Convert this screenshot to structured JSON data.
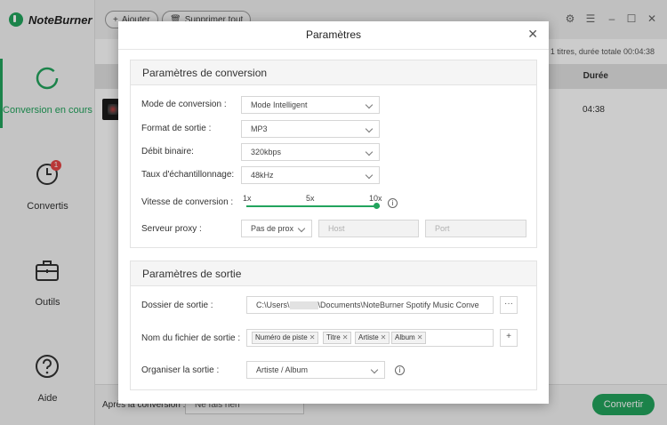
{
  "app": {
    "name": "NoteBurner"
  },
  "sidebar": {
    "items": [
      {
        "label": "Conversion en cours",
        "icon": "conversion-ring-icon",
        "active": true
      },
      {
        "label": "Convertis",
        "icon": "clock-icon",
        "badge": "1"
      },
      {
        "label": "Outils",
        "icon": "toolbox-icon"
      },
      {
        "label": "Aide",
        "icon": "help-icon"
      }
    ]
  },
  "toolbar": {
    "add_label": "Ajouter",
    "remove_all_label": "Supprimer tout"
  },
  "main": {
    "summary": "1 titres, durée totale 00:04:38",
    "col_duration": "Durée",
    "track_duration": "04:38"
  },
  "footer": {
    "after_label": "Après la conversion :",
    "after_value": "Ne fais rien",
    "convert_label": "Convertir"
  },
  "dialog": {
    "title": "Paramètres",
    "conversion": {
      "header": "Paramètres de conversion",
      "mode_label": "Mode de conversion :",
      "mode_value": "Mode Intelligent",
      "format_label": "Format de sortie :",
      "format_value": "MP3",
      "bitrate_label": "Débit binaire:",
      "bitrate_value": "320kbps",
      "samplerate_label": "Taux d'échantillonnage:",
      "samplerate_value": "48kHz",
      "speed_label": "Vitesse de conversion :",
      "speed_ticks": [
        "1x",
        "5x",
        "10x"
      ],
      "speed_value": "10x",
      "proxy_label": "Serveur proxy :",
      "proxy_value": "Pas de prox",
      "host_placeholder": "Host",
      "port_placeholder": "Port"
    },
    "output": {
      "header": "Paramètres de sortie",
      "folder_label": "Dossier de sortie :",
      "folder_value_prefix": "C:\\Users\\",
      "folder_value_suffix": "\\Documents\\NoteBurner Spotify Music Conve",
      "browse_label": "···",
      "filename_label": "Nom du fichier de sortie :",
      "filename_tags": [
        "Numéro de piste",
        "Titre",
        "Artiste",
        "Album"
      ],
      "add_tag_label": "+",
      "organize_label": "Organiser la sortie :",
      "organize_value": "Artiste / Album"
    }
  },
  "colors": {
    "accent": "#22a45d",
    "badge": "#e64545"
  }
}
